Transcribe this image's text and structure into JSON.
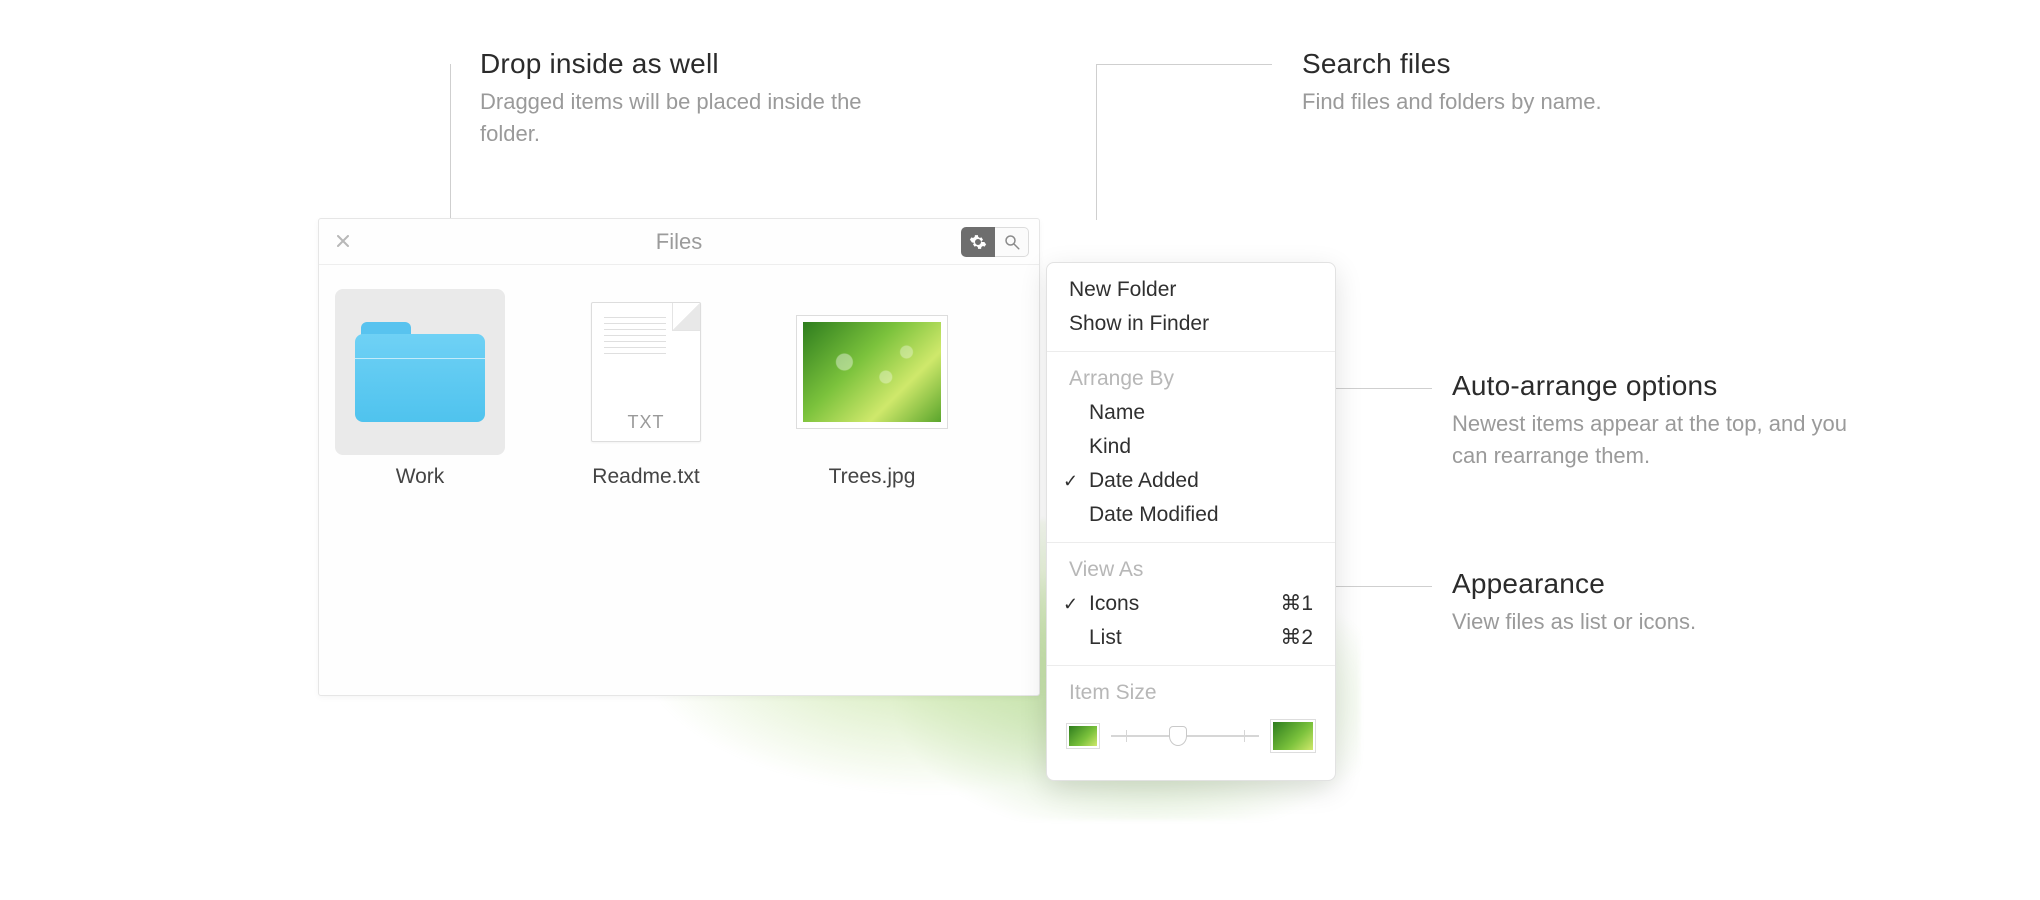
{
  "callouts": {
    "drop": {
      "title": "Drop inside as well",
      "body": "Dragged items will be placed inside the folder."
    },
    "search": {
      "title": "Search files",
      "body": "Find files and folders by name."
    },
    "arrange": {
      "title": "Auto-arrange options",
      "body": "Newest items appear at the top, and you can rearrange them."
    },
    "view": {
      "title": "Appearance",
      "body": "View files as list or icons."
    }
  },
  "panel": {
    "title": "Files",
    "items": [
      {
        "label": "Work",
        "kind": "folder",
        "selected": true
      },
      {
        "label": "Readme.txt",
        "kind": "txt",
        "ext": "TXT"
      },
      {
        "label": "Trees.jpg",
        "kind": "image"
      }
    ]
  },
  "menu": {
    "top": [
      {
        "label": "New Folder"
      },
      {
        "label": "Show in Finder"
      }
    ],
    "arrange_header": "Arrange By",
    "arrange": [
      {
        "label": "Name"
      },
      {
        "label": "Kind"
      },
      {
        "label": "Date Added",
        "checked": true
      },
      {
        "label": "Date Modified"
      }
    ],
    "view_header": "View As",
    "view": [
      {
        "label": "Icons",
        "shortcut": "⌘1",
        "checked": true
      },
      {
        "label": "List",
        "shortcut": "⌘2"
      }
    ],
    "size_header": "Item Size"
  }
}
